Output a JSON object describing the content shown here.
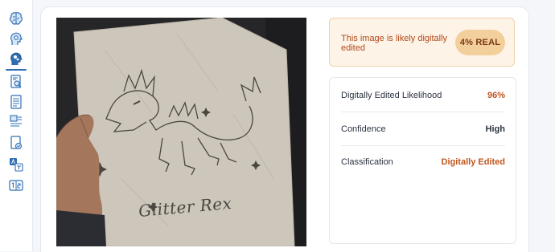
{
  "sidebar": {
    "items": [
      {
        "icon": "brain-icon"
      },
      {
        "icon": "head-profile-icon"
      },
      {
        "icon": "head-gears-icon",
        "active": true
      },
      {
        "icon": "document-search-icon"
      },
      {
        "icon": "document-list-icon"
      },
      {
        "icon": "image-text-icon"
      },
      {
        "icon": "document-check-icon"
      },
      {
        "icon": "translate-icon"
      },
      {
        "icon": "one-two-icon"
      }
    ]
  },
  "image": {
    "caption_on_paper": "Glitter Rex"
  },
  "verdict": {
    "text": "This image is likely digitally edited",
    "badge": "4% REAL"
  },
  "details": [
    {
      "label": "Digitally Edited Likelihood",
      "value": "96%",
      "tone": "orange"
    },
    {
      "label": "Confidence",
      "value": "High",
      "tone": "dark"
    },
    {
      "label": "Classification",
      "value": "Digitally Edited",
      "tone": "orange"
    }
  ],
  "colors": {
    "accent": "#2f6fb5",
    "warning_text": "#b24a1c",
    "badge_bg": "#f3cf9c",
    "verdict_bg": "#fdf3e6"
  }
}
